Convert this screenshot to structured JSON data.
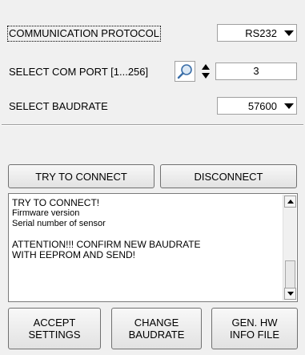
{
  "settings": {
    "protocol_label": "COMMUNICATION PROTOCOL",
    "protocol_value": "RS232",
    "comport_label": "SELECT COM PORT [1...256]",
    "comport_value": "3",
    "baudrate_label": "SELECT BAUDRATE",
    "baudrate_value": "57600"
  },
  "connection": {
    "connect_label": "TRY TO CONNECT",
    "disconnect_label": "DISCONNECT"
  },
  "log": {
    "line1": "TRY TO CONNECT!",
    "line2": "Firmware version",
    "line3": "Serial number of sensor",
    "line4": "ATTENTION!!!  CONFIRM NEW BAUDRATE",
    "line5": "WITH EEPROM AND SEND!"
  },
  "actions": {
    "accept_line1": "ACCEPT",
    "accept_line2": "SETTINGS",
    "change_line1": "CHANGE",
    "change_line2": "BAUDRATE",
    "genhw_line1": "GEN. HW",
    "genhw_line2": "INFO FILE"
  },
  "icons": {
    "search": "search-icon",
    "spinner": "spinner-icon",
    "dropdown": "chevron-down-icon"
  }
}
